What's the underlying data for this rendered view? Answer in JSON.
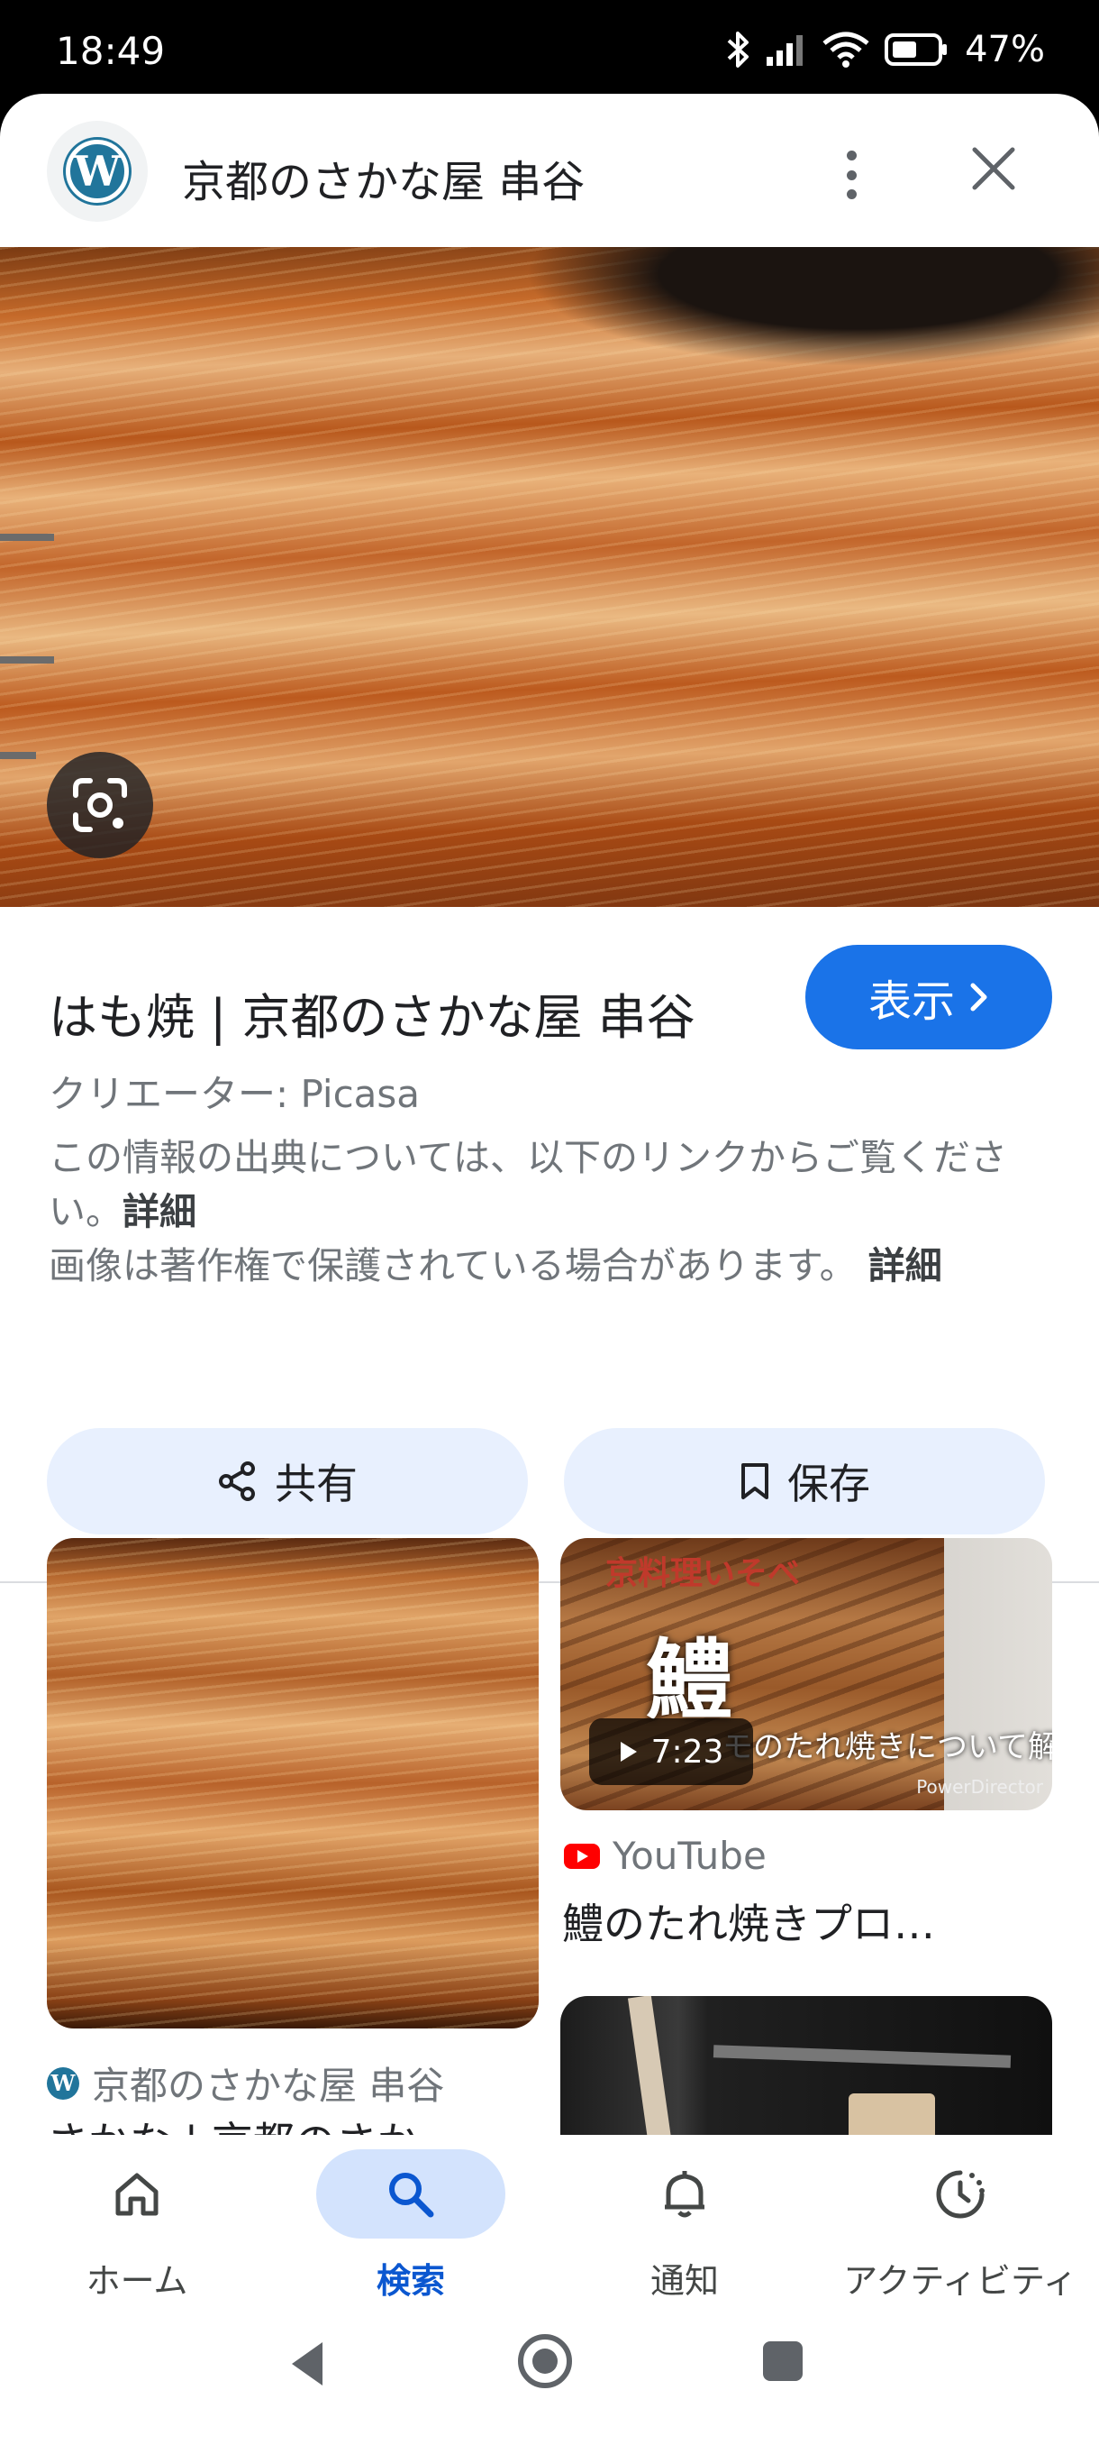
{
  "status_bar": {
    "time": "18:49",
    "battery": "47%"
  },
  "header": {
    "title": "京都のさかな屋 串谷",
    "logo_letter": "W"
  },
  "result": {
    "title": "はも焼 | 京都のさかな屋 串谷",
    "visit_label": "表示",
    "creator": "クリエーター: Picasa",
    "source_notice": "この情報の出典については、以下のリンクからご覧ください。",
    "details_label_1": "詳細",
    "copyright_notice": "画像は著作権で保護されている場合があります。",
    "details_label_2": "詳細",
    "share_label": "共有",
    "save_label": "保存"
  },
  "related": [
    {
      "source": "京都のさかな屋 串谷",
      "title": "さかな | 京都のさか…"
    },
    {
      "source": "YouTube",
      "title": "鱧のたれ焼きプロ…",
      "duration": "7:23",
      "thumb_title": "京料理いそべ",
      "thumb_kanji": "鱧",
      "thumb_subtitle": "モのたれ焼きについて解説",
      "thumb_watermark": "PowerDirector"
    }
  ],
  "bottom_nav": [
    {
      "label": "ホーム",
      "icon": "home-icon",
      "active": false
    },
    {
      "label": "検索",
      "icon": "search-icon",
      "active": true
    },
    {
      "label": "通知",
      "icon": "bell-icon",
      "active": false
    },
    {
      "label": "アクティビティ",
      "icon": "activity-icon",
      "active": false
    }
  ],
  "colors": {
    "accent": "#1a73e8",
    "pill_bg": "#e8f0fe",
    "active_nav": "#0b57d0",
    "youtube": "#ff0000"
  }
}
